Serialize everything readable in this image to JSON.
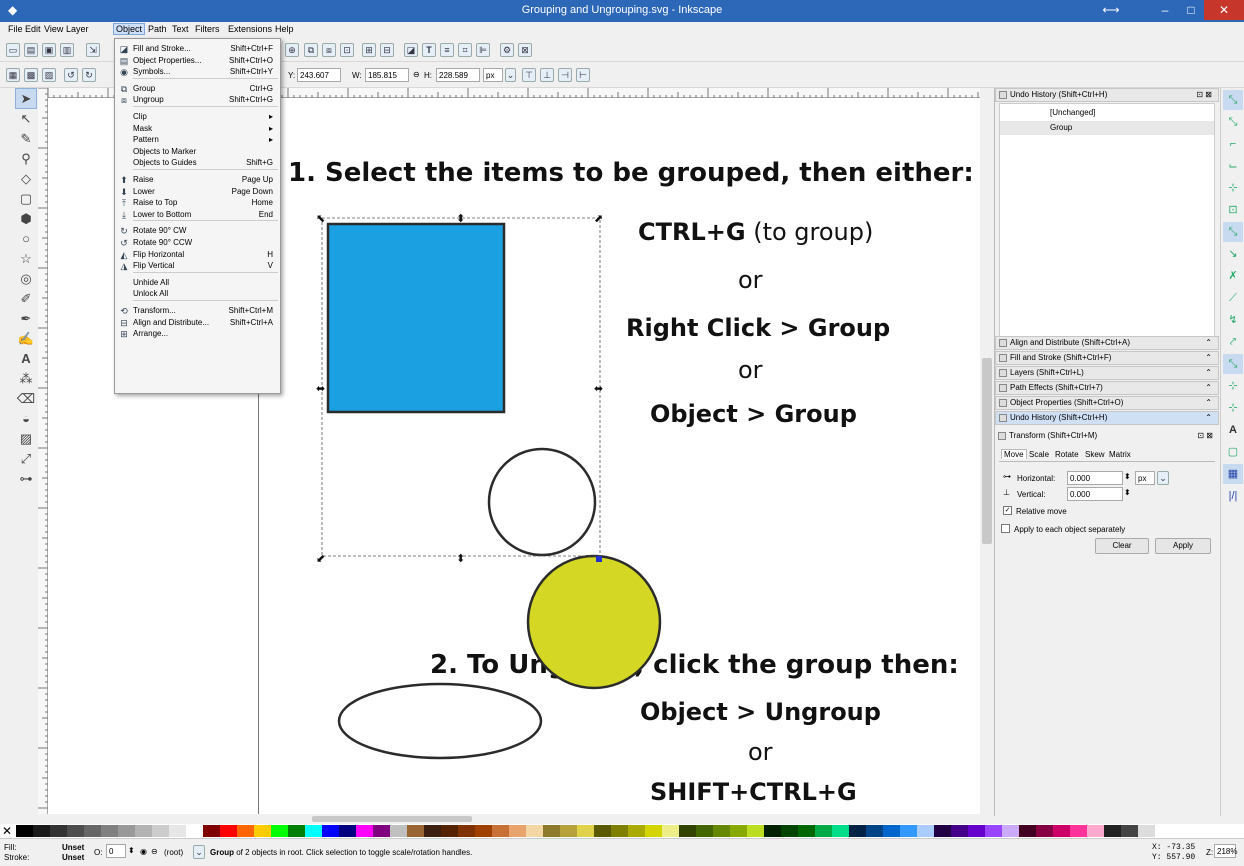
{
  "window": {
    "title": "Grouping and Ungrouping.svg - Inkscape",
    "min": "–",
    "max": "□",
    "close": "✕",
    "restore": "⟷"
  },
  "menubar": [
    "File",
    "Edit",
    "View",
    "Layer",
    "Object",
    "Path",
    "Text",
    "Filters",
    "Extensions",
    "Help"
  ],
  "toolbar": {
    "y_label": "Y:",
    "y_value": "243.607",
    "w_label": "W:",
    "w_value": "185.815",
    "h_label": "H:",
    "h_value": "228.589",
    "unit": "px"
  },
  "object_menu": [
    {
      "icon": "fill-stroke-icon",
      "glyph": "◪",
      "label": "Fill and Stroke...",
      "shortcut": "Shift+Ctrl+F"
    },
    {
      "icon": "object-properties-icon",
      "glyph": "▤",
      "label": "Object Properties...",
      "shortcut": "Shift+Ctrl+O"
    },
    {
      "icon": "symbols-icon",
      "glyph": "◉",
      "label": "Symbols...",
      "shortcut": "Shift+Ctrl+Y"
    },
    {
      "sep": true
    },
    {
      "icon": "group-icon",
      "glyph": "⧉",
      "label": "Group",
      "shortcut": "Ctrl+G"
    },
    {
      "icon": "ungroup-icon",
      "glyph": "⧈",
      "label": "Ungroup",
      "shortcut": "Shift+Ctrl+G"
    },
    {
      "sep": true
    },
    {
      "label": "Clip",
      "shortcut": "▸"
    },
    {
      "label": "Mask",
      "shortcut": "▸"
    },
    {
      "label": "Pattern",
      "shortcut": "▸"
    },
    {
      "label": "Objects to Marker",
      "shortcut": ""
    },
    {
      "label": "Objects to Guides",
      "shortcut": "Shift+G"
    },
    {
      "sep": true
    },
    {
      "icon": "raise-icon",
      "glyph": "⬆",
      "label": "Raise",
      "shortcut": "Page Up"
    },
    {
      "icon": "lower-icon",
      "glyph": "⬇",
      "label": "Lower",
      "shortcut": "Page Down"
    },
    {
      "icon": "raise-top-icon",
      "glyph": "⤒",
      "label": "Raise to Top",
      "shortcut": "Home"
    },
    {
      "icon": "lower-bottom-icon",
      "glyph": "⤓",
      "label": "Lower to Bottom",
      "shortcut": "End"
    },
    {
      "sep": true
    },
    {
      "icon": "rotate-cw-icon",
      "glyph": "↻",
      "label": "Rotate 90° CW",
      "shortcut": ""
    },
    {
      "icon": "rotate-ccw-icon",
      "glyph": "↺",
      "label": "Rotate 90° CCW",
      "shortcut": ""
    },
    {
      "icon": "flip-horizontal-icon",
      "glyph": "◭",
      "label": "Flip Horizontal",
      "shortcut": "H"
    },
    {
      "icon": "flip-vertical-icon",
      "glyph": "◮",
      "label": "Flip Vertical",
      "shortcut": "V"
    },
    {
      "sep": true
    },
    {
      "label": "Unhide All",
      "shortcut": ""
    },
    {
      "label": "Unlock All",
      "shortcut": ""
    },
    {
      "sep": true
    },
    {
      "icon": "transform-icon",
      "glyph": "⟲",
      "label": "Transform...",
      "shortcut": "Shift+Ctrl+M"
    },
    {
      "icon": "align-icon",
      "glyph": "⊟",
      "label": "Align and Distribute...",
      "shortcut": "Shift+Ctrl+A"
    },
    {
      "icon": "arrange-icon",
      "glyph": "⊞",
      "label": "Arrange...",
      "shortcut": ""
    }
  ],
  "canvas": {
    "step1": "1. Select the items to be grouped, then either:",
    "ctrl_g": "CTRL+G",
    "to_group": " (to group)",
    "or1": "or",
    "right_click": "Right Click > Group",
    "or2": "or",
    "object_group": "Object > Group",
    "step2": "2. To Ungroup, click the group then:",
    "object_ungroup": "Object > Ungroup",
    "or3": "or",
    "shift_ctrl_g": "SHIFT+CTRL+G",
    "colors": {
      "rect_fill": "#1ba1e2",
      "circle_fill": "#d4d824",
      "stroke": "#2b2b2b"
    }
  },
  "undo_history": {
    "title": "Undo History (Shift+Ctrl+H)",
    "items": [
      "[Unchanged]",
      "Group"
    ]
  },
  "panels": [
    "Align and Distribute (Shift+Ctrl+A)",
    "Fill and Stroke (Shift+Ctrl+F)",
    "Layers (Shift+Ctrl+L)",
    "Path Effects  (Shift+Ctrl+7)",
    "Object Properties (Shift+Ctrl+O)",
    "Undo History (Shift+Ctrl+H)"
  ],
  "transform": {
    "title": "Transform (Shift+Ctrl+M)",
    "tabs": [
      "Move",
      "Scale",
      "Rotate",
      "Skew",
      "Matrix"
    ],
    "horizontal_label": "Horizontal:",
    "horizontal_value": "0.000",
    "vertical_label": "Vertical:",
    "vertical_value": "0.000",
    "unit": "px",
    "relative_move": "Relative move",
    "apply_each": "Apply to each object separately",
    "clear": "Clear",
    "apply": "Apply"
  },
  "status": {
    "fill_label": "Fill:",
    "fill_value": "Unset",
    "stroke_label": "Stroke:",
    "stroke_value": "Unset",
    "opacity_label": "O:",
    "opacity_value": "0",
    "layer": "(root)",
    "message_bold": "Group",
    "message": " of 2 objects in root. Click selection to toggle scale/rotation handles.",
    "x": "X:  -73.35",
    "y": "Y:  557.90",
    "zoom_label": "Z:",
    "zoom": "218%"
  },
  "palette": [
    "#000000",
    "#1a1a1a",
    "#333333",
    "#4d4d4d",
    "#666666",
    "#808080",
    "#999999",
    "#b3b3b3",
    "#cccccc",
    "#e6e6e6",
    "#ffffff",
    "#800000",
    "#ff0000",
    "#ff6600",
    "#ffcc00",
    "#00ff00",
    "#008000",
    "#00ffff",
    "#0000ff",
    "#000080",
    "#ff00ff",
    "#800080",
    "#c0c0c0",
    "#996633",
    "#3b1f0f",
    "#552200",
    "#803300",
    "#a04000",
    "#c87137",
    "#e9a46e",
    "#f4d7a5",
    "#8e7a2b",
    "#b7a13a",
    "#e0d24a",
    "#5a5a00",
    "#7f7f00",
    "#aaaa00",
    "#d4d400",
    "#eeee88",
    "#334400",
    "#446600",
    "#668800",
    "#88aa00",
    "#bbdd22",
    "#002200",
    "#004400",
    "#006600",
    "#00aa44",
    "#00dd88",
    "#002244",
    "#004488",
    "#0066cc",
    "#3399ff",
    "#aaccff",
    "#220044",
    "#440088",
    "#6600cc",
    "#9944ff",
    "#ccaaff",
    "#440022",
    "#880044",
    "#cc0066",
    "#ff3399",
    "#ffaacc",
    "#222222",
    "#444444",
    "#dddddd"
  ]
}
